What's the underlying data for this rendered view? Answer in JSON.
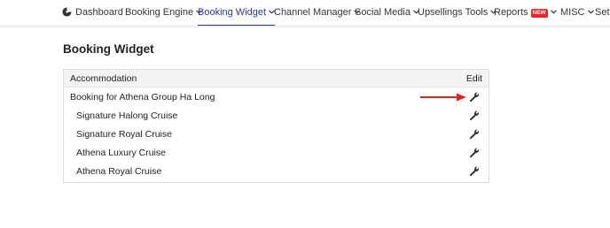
{
  "nav": {
    "items": [
      {
        "label": "Dashboard",
        "icon": "dashboard-icon",
        "has_caret": false
      },
      {
        "label": "Booking Engine",
        "has_caret": true
      },
      {
        "label": "Booking Widget",
        "has_caret": true,
        "active": true
      },
      {
        "label": "Channel Manager",
        "has_caret": true
      },
      {
        "label": "Social Media",
        "has_caret": true
      },
      {
        "label": "Upsellings Tools",
        "has_caret": true
      },
      {
        "label": "Reports",
        "badge": "NEW",
        "has_caret": true
      },
      {
        "label": "MISC",
        "has_caret": true
      },
      {
        "label": "Setu"
      }
    ],
    "accent_color": "#2a3694",
    "badge_color": "#e8262e"
  },
  "page": {
    "title": "Booking Widget"
  },
  "table": {
    "headers": {
      "accommodation": "Accommodation",
      "edit": "Edit"
    },
    "rows": [
      {
        "label": "Booking for Athena Group Ha Long",
        "level": "parent",
        "edit_icon": "wrench-icon"
      },
      {
        "label": "Signature Halong Cruise",
        "level": "child",
        "edit_icon": "wrench-icon"
      },
      {
        "label": "Signature Royal Cruise",
        "level": "child",
        "edit_icon": "wrench-icon"
      },
      {
        "label": "Athena Luxury Cruise",
        "level": "child",
        "edit_icon": "wrench-icon"
      },
      {
        "label": "Athena Royal Cruise",
        "level": "child",
        "edit_icon": "wrench-icon"
      }
    ]
  },
  "annotation": {
    "icon": "red-arrow-icon",
    "color": "#e3241e"
  }
}
